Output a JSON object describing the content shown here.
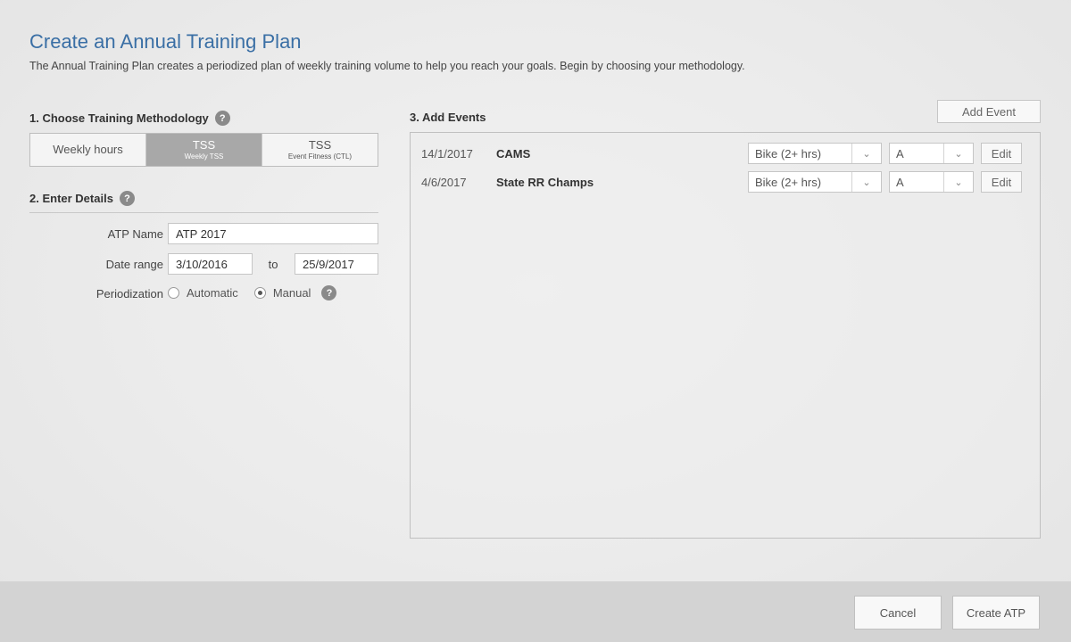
{
  "header": {
    "title": "Create an Annual Training Plan",
    "subtitle": "The Annual Training Plan creates a periodized plan of weekly training volume to help you reach your goals. Begin by choosing your methodology."
  },
  "methodology": {
    "label": "1. Choose Training Methodology",
    "options": [
      {
        "main": "Weekly hours",
        "sub": ""
      },
      {
        "main": "TSS",
        "sub": "Weekly TSS"
      },
      {
        "main": "TSS",
        "sub": "Event Fitness (CTL)"
      }
    ],
    "selected": "Weekly TSS"
  },
  "details": {
    "label": "2. Enter Details",
    "atp_name_label": "ATP Name",
    "atp_name_value": "ATP 2017",
    "date_range_label": "Date range",
    "date_start": "3/10/2016",
    "to_label": "to",
    "date_end": "25/9/2017",
    "periodization_label": "Periodization",
    "periodization_options": [
      "Automatic",
      "Manual"
    ],
    "periodization_selected": "Manual"
  },
  "events": {
    "label": "3. Add Events",
    "add_button": "Add Event",
    "rows": [
      {
        "date": "14/1/2017",
        "name": "CAMS",
        "type": "Bike (2+ hrs)",
        "priority": "A",
        "edit": "Edit"
      },
      {
        "date": "4/6/2017",
        "name": "State RR Champs",
        "type": "Bike (2+ hrs)",
        "priority": "A",
        "edit": "Edit"
      }
    ]
  },
  "footer": {
    "cancel": "Cancel",
    "create": "Create ATP"
  },
  "icons": {
    "help": "help-icon",
    "caret": "chevron-down-icon"
  },
  "colors": {
    "title": "#3a6fa5",
    "active_toggle": "#a8a8a8",
    "footer_bg": "#d3d3d3"
  }
}
